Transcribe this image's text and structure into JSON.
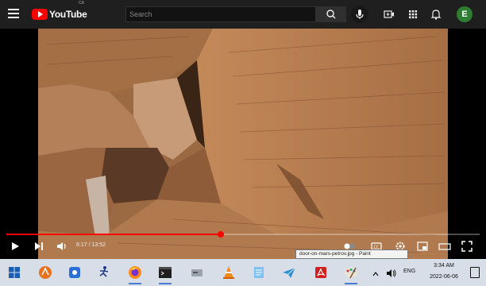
{
  "browser": {
    "logo_text": "YouTube",
    "logo_country": "CA",
    "search": {
      "placeholder": "Search",
      "value": ""
    },
    "avatar_letter": "E"
  },
  "player": {
    "current_time": "6:17",
    "duration": "13:52",
    "time_display": "6:17 / 13:52",
    "progress": 0.453,
    "tooltip": "door-on-mars-petrov.jpg - Paint"
  },
  "taskbar": {
    "apps": [
      "start",
      "search",
      "task-view",
      "vlc-orange",
      "stick-figure",
      "firefox",
      "terminal",
      "disk-tool",
      "vlc",
      "notes",
      "paper-plane",
      "acrobat",
      "paint"
    ],
    "language": "ENG",
    "time": "3:34 AM",
    "date": "2022-06-06"
  },
  "colors": {
    "accent": "#ff0000",
    "header_bg": "#1f1f1f",
    "taskbar_bg": "#d8dee8"
  }
}
